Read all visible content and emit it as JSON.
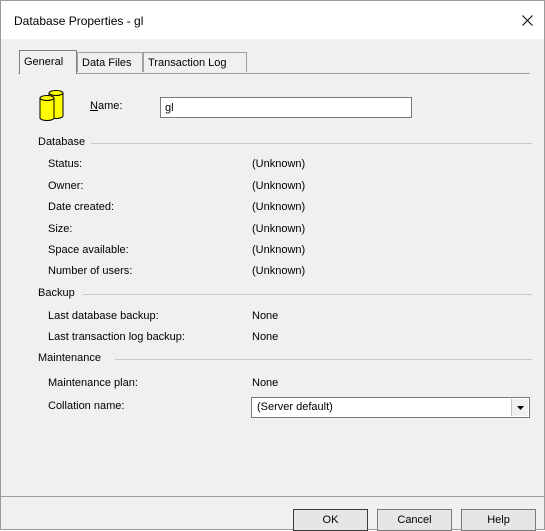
{
  "window": {
    "title": "Database Properties - gl"
  },
  "tabs": [
    {
      "label": "General",
      "active": true
    },
    {
      "label": "Data Files",
      "active": false
    },
    {
      "label": "Transaction Log",
      "active": false
    }
  ],
  "name": {
    "label_underlined": "N",
    "label_rest": "ame:",
    "value": "gl"
  },
  "database": {
    "title": "Database",
    "rows": [
      {
        "label": "Status:",
        "value": "(Unknown)"
      },
      {
        "label": "Owner:",
        "value": "(Unknown)"
      },
      {
        "label": "Date created:",
        "value": "(Unknown)"
      },
      {
        "label": "Size:",
        "value": "(Unknown)"
      },
      {
        "label": "Space available:",
        "value": "(Unknown)"
      },
      {
        "label": "Number of users:",
        "value": "(Unknown)"
      }
    ]
  },
  "backup": {
    "title": "Backup",
    "rows": [
      {
        "label": "Last database backup:",
        "value": "None"
      },
      {
        "label": "Last transaction log backup:",
        "value": "None"
      }
    ]
  },
  "maintenance": {
    "title": "Maintenance",
    "plan": {
      "label": "Maintenance plan:",
      "value": "None"
    },
    "collation": {
      "label": "Collation name:",
      "value": "(Server default)"
    }
  },
  "buttons": {
    "ok": "OK",
    "cancel": "Cancel",
    "help": "Help"
  },
  "colors": {
    "icon_yellow": "#ffff00",
    "icon_outline": "#000000"
  }
}
